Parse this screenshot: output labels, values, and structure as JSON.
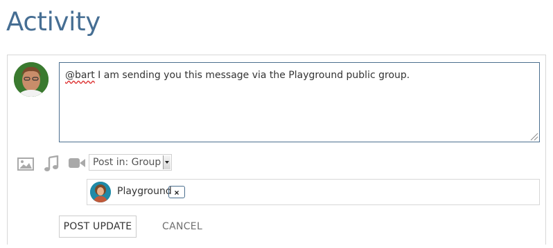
{
  "page": {
    "title": "Activity"
  },
  "composer": {
    "message_mention": "@bart",
    "message_rest": " I am sending you this message via the Playground public group.",
    "post_in_value": "Post in: Group",
    "group": {
      "name": "Playground",
      "remove_label": "×"
    },
    "post_button_label": "POST UPDATE",
    "cancel_label": "CANCEL"
  },
  "icons": [
    "image-icon",
    "music-icon",
    "video-icon",
    "resize-grip-icon"
  ],
  "colors": {
    "title": "#466e93",
    "textarea_border": "#4a6e8e",
    "icon": "#a9a9a9"
  }
}
